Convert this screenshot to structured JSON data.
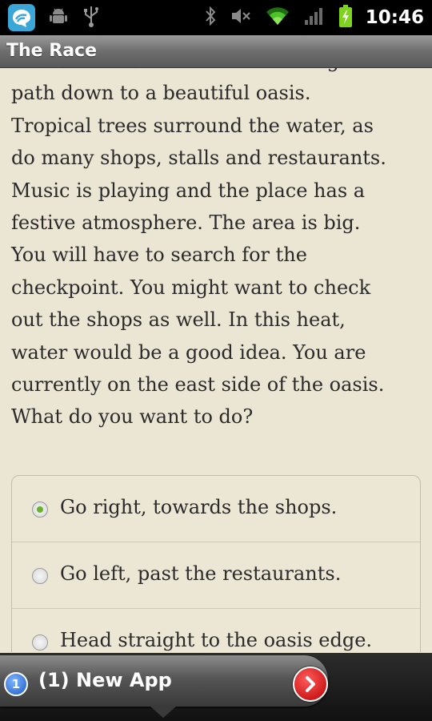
{
  "status_bar": {
    "time": "10:46",
    "left_icons": [
      "app-icon",
      "android-debug-icon",
      "usb-icon"
    ],
    "right_icons": [
      "bluetooth-icon",
      "mute-icon",
      "wifi-icon",
      "signal-icon",
      "battery-icon"
    ]
  },
  "title": "The Race",
  "story": {
    "lines": [
      "ahead curves to the left revealing a",
      "path down to a beautiful oasis.",
      "Tropical trees surround the water, as",
      "do many shops, stalls and restaurants.",
      "Music is playing and the place has a",
      "festive atmosphere. The area is big.",
      "You will have to search for the",
      "checkpoint. You might want to check",
      "out the shops as well. In this heat,",
      "water would be a good idea. You are",
      "currently on the east side of the oasis.",
      "What do you want to do?"
    ]
  },
  "choices": [
    {
      "label": "Go right, towards the shops.",
      "selected": true
    },
    {
      "label": "Go left, past the restaurants.",
      "selected": false
    },
    {
      "label": "Head straight to the oasis edge.",
      "selected": false
    }
  ],
  "notification": {
    "count": "1",
    "text": "(1) New App"
  },
  "colors": {
    "background": "#ebe5d3",
    "selected_radio": "#68b22b",
    "notification_arrow": "#d10000"
  }
}
